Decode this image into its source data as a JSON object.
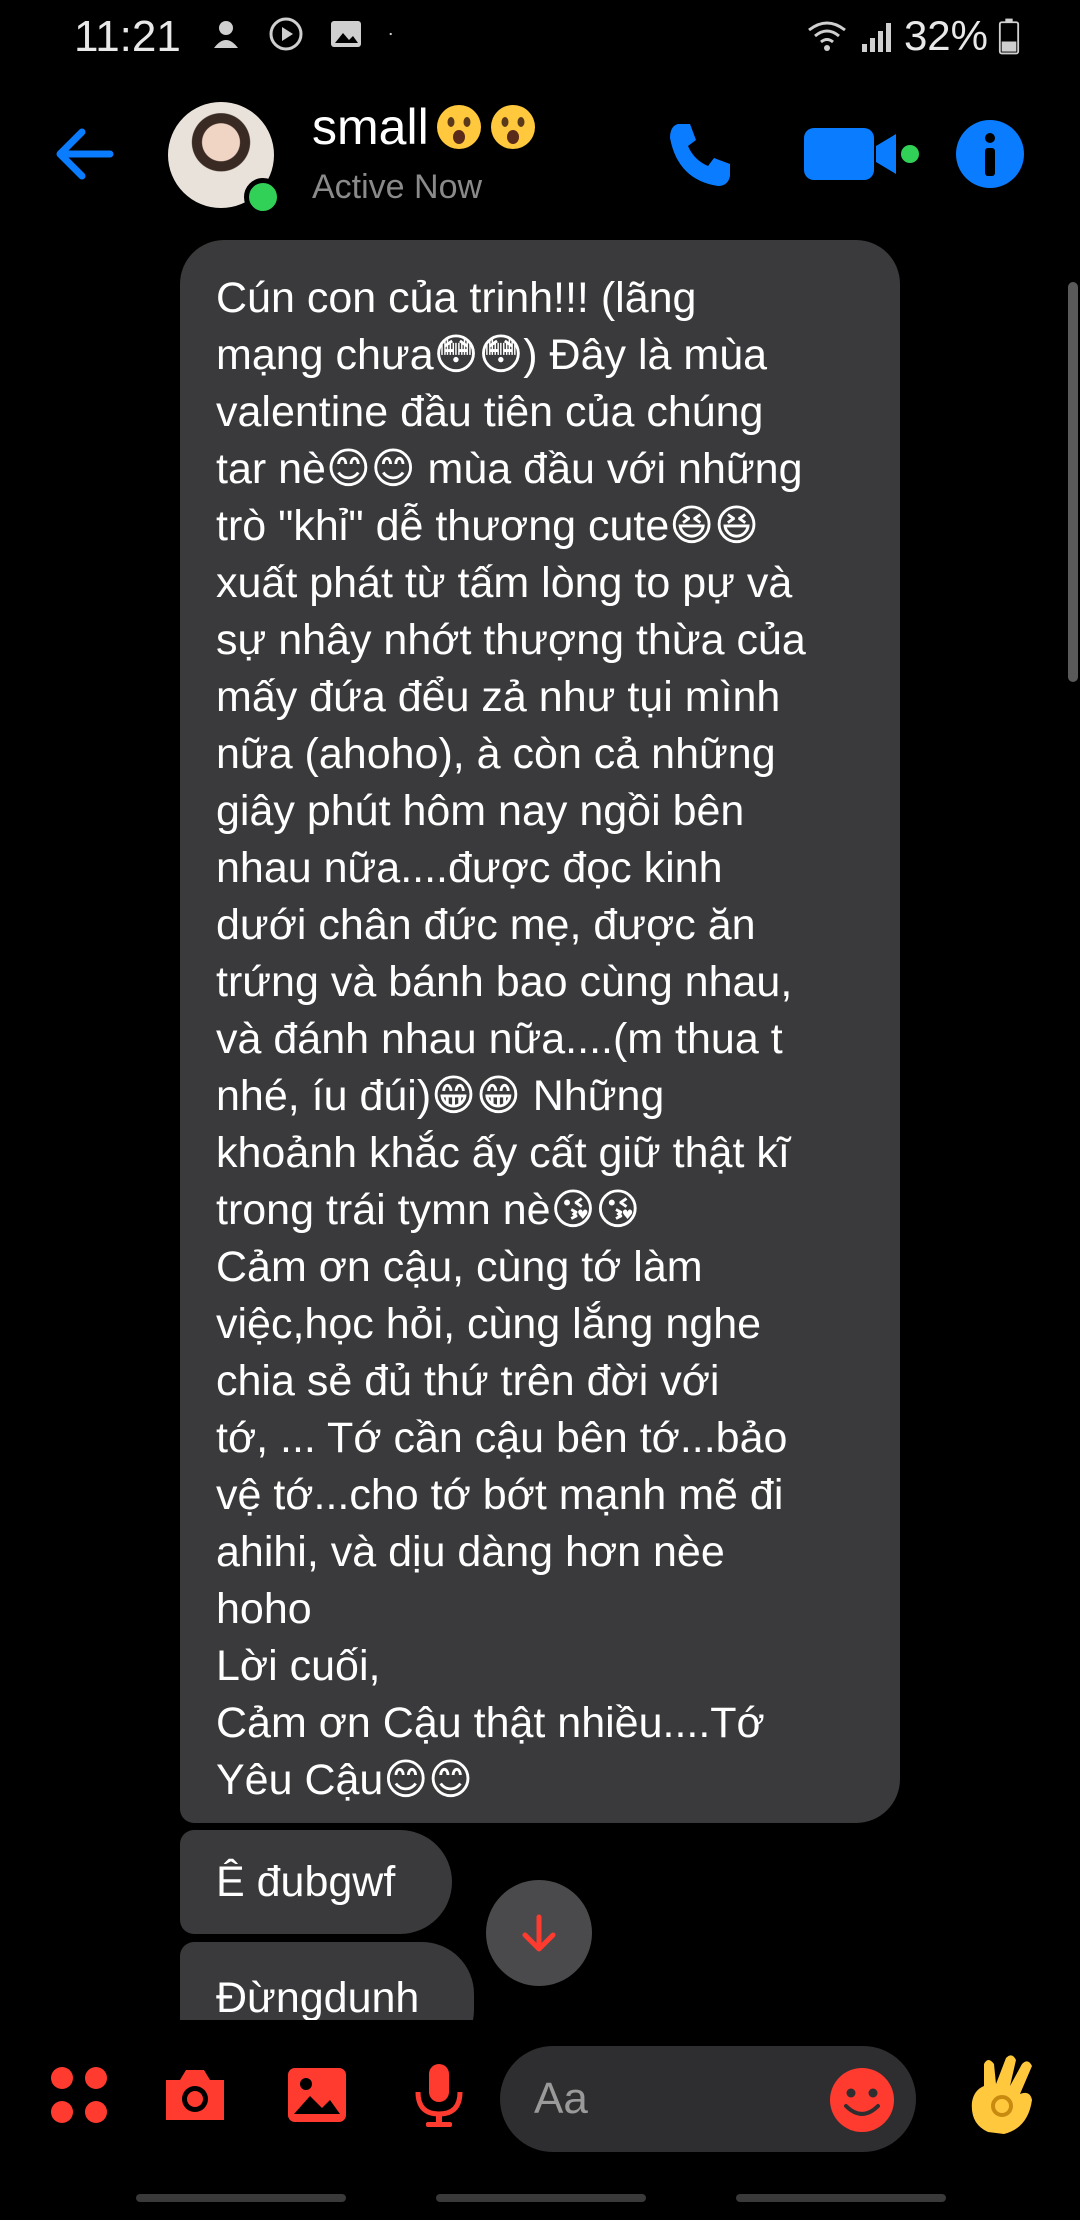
{
  "status_bar": {
    "time": "11:21",
    "battery_percent": "32%",
    "left_icons": [
      "notification-icon",
      "record-icon",
      "image-icon",
      "dot-icon"
    ],
    "right_icons": [
      "wifi-icon",
      "signal-icon",
      "battery-icon"
    ]
  },
  "header": {
    "contact_name": "small",
    "name_emoji": [
      "astonished-emoji",
      "astonished-emoji"
    ],
    "presence": "Active Now",
    "accent_color": "#0a7cff"
  },
  "messages": [
    {
      "sender": "contact",
      "text": "Cún con của trinh!!! (lãng\nmạng chưa😳😳) Đây là mùa\nvalentine đầu tiên của chúng\ntar nè😊😊 mùa đầu với những\ntrò \"khỉ\" dễ thương cute😆😆\nxuất phát từ tấm lòng to pự và\nsự nhây nhớt thượng thừa của\nmấy đứa đểu zả như tụi mình\nnữa (ahoho), à còn cả những\ngiây phút hôm nay ngồi bên\nnhau nữa....được đọc kinh\ndưới chân đức mẹ, được ăn\ntrứng và bánh bao cùng nhau,\nvà đánh nhau nữa....(m thua t\nnhé, íu đúi)😁😁 Những\nkhoảnh khắc ấy cất giữ thật kĩ\ntrong trái tymn nè😘😘\nCảm ơn cậu, cùng tớ làm\nviệc,học hỏi, cùng lắng nghe\nchia sẻ đủ thứ trên đời với\ntớ, ... Tớ cần cậu bên tớ...bảo\nvệ tớ...cho tớ bớt mạnh mẽ đi\nahihi, và dịu dàng hơn nèe\nhoho\nLời cuối,\nCảm ơn Cậu thật nhiều....Tớ\nYêu Cậu😊😊"
    },
    {
      "sender": "contact",
      "text": "Ê đubgwf"
    },
    {
      "sender": "contact",
      "text": "Đừngdunh"
    }
  ],
  "composer": {
    "placeholder": "Aa",
    "accent_color": "#ff3b30",
    "icons": [
      "menu-icon",
      "camera-icon",
      "gallery-icon",
      "microphone-icon",
      "emoji-icon",
      "ok-hand-icon"
    ]
  }
}
